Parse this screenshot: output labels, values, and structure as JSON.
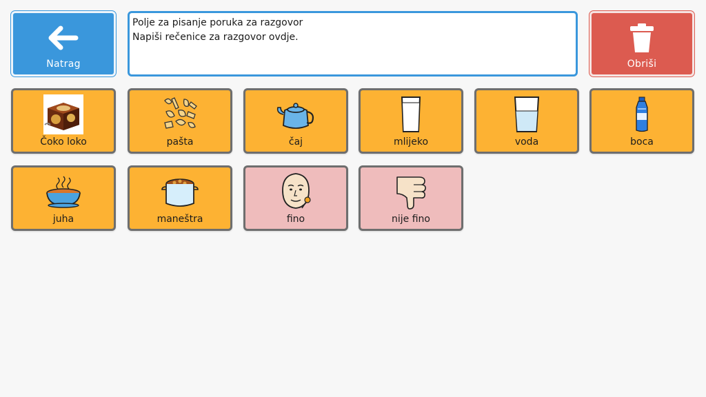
{
  "header": {
    "back_label": "Natrag",
    "delete_label": "Obriši",
    "message_lines": [
      "Polje za pisanje poruka za razgovor",
      "Napiši rečenice za razgovor ovdje."
    ]
  },
  "tiles": [
    {
      "label": "Čoko loko",
      "icon": "cocoa-box-icon"
    },
    {
      "label": "pašta",
      "icon": "pasta-icon"
    },
    {
      "label": "čaj",
      "icon": "teapot-icon"
    },
    {
      "label": "mlijeko",
      "icon": "milk-glass-icon"
    },
    {
      "label": "voda",
      "icon": "water-glass-icon"
    },
    {
      "label": "boca",
      "icon": "water-bottle-icon"
    },
    {
      "label": "juha",
      "icon": "soup-bowl-icon"
    },
    {
      "label": "maneštra",
      "icon": "stew-pot-icon"
    },
    {
      "label": "fino",
      "icon": "yummy-face-icon"
    },
    {
      "label": "nije fino",
      "icon": "thumbs-down-icon"
    }
  ],
  "colors": {
    "tile_food": "#fdb233",
    "tile_feeling": "#efbcbc",
    "back": "#3a97dc",
    "delete": "#dc5b50"
  }
}
